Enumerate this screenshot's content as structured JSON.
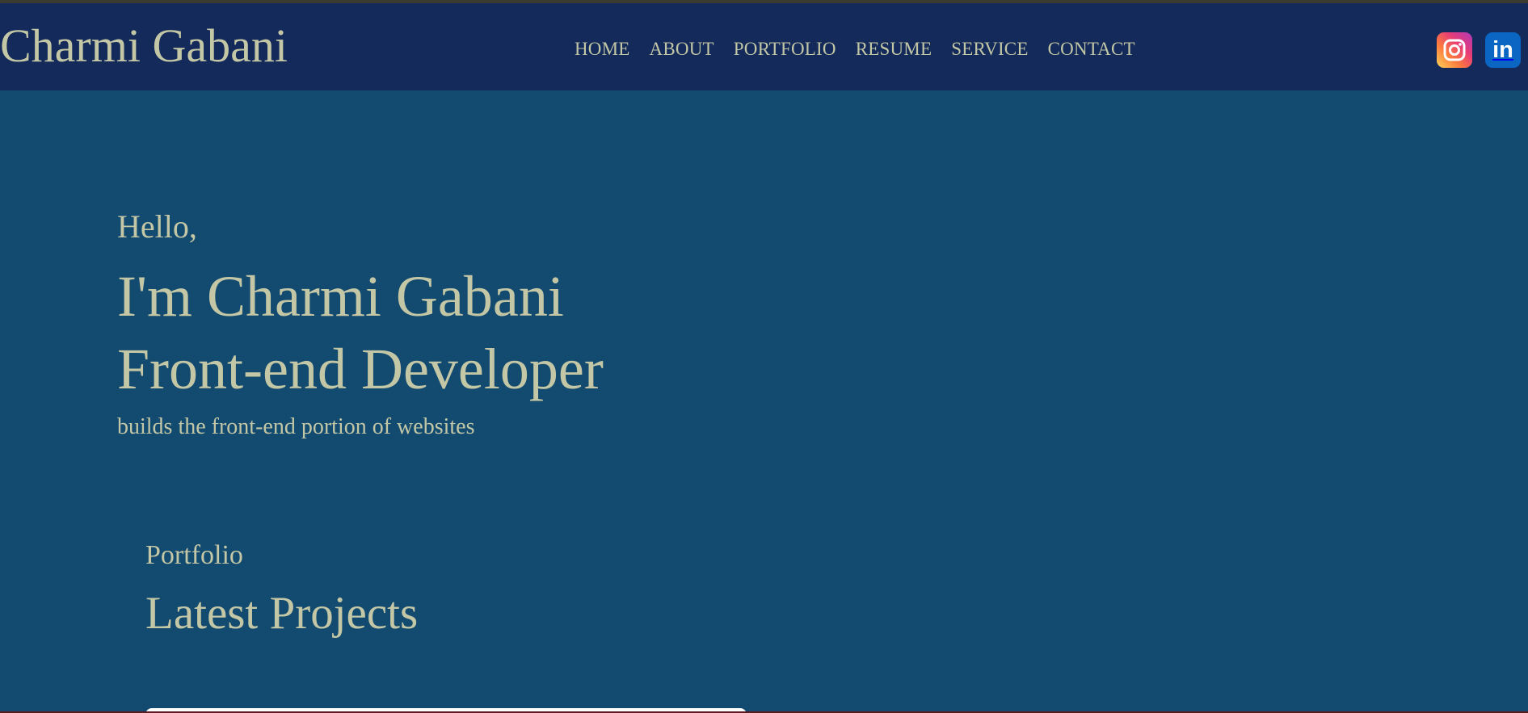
{
  "header": {
    "brand": "Charmi Gabani",
    "nav": [
      "HOME",
      "ABOUT",
      "PORTFOLIO",
      "RESUME",
      "SERVICE",
      "CONTACT"
    ]
  },
  "social": [
    {
      "icon": "instagram-icon",
      "color": "#e83c76"
    },
    {
      "icon": "linkedin-icon",
      "color": "#0a66c2",
      "glyph": "in"
    }
  ],
  "hero": {
    "greeting": "Hello,",
    "name": "I'm Charmi Gabani",
    "role": "Front-end Developer",
    "description": "builds the front-end portion of websites"
  },
  "portfolio": {
    "kicker": "Portfolio",
    "title": "Latest Projects"
  },
  "colors": {
    "background": "#134b70",
    "header": "#132a5a",
    "text": "#c3c7a6"
  }
}
